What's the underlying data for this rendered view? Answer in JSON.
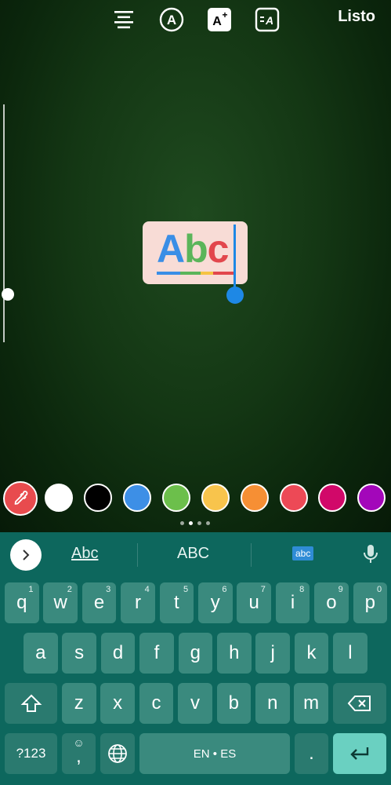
{
  "toolbar": {
    "done_label": "Listo",
    "icons": [
      "align-center-icon",
      "font-style-icon",
      "text-effects-icon",
      "text-animation-icon"
    ]
  },
  "sticker": {
    "text": "Abc",
    "letters": [
      {
        "ch": "A",
        "color": "#3a8ee6"
      },
      {
        "ch": "b",
        "color": "#5bb55a"
      },
      {
        "ch": "c",
        "color": "#e2474d"
      }
    ],
    "underline_colors": [
      "#3a8ee6",
      "#5bb55a",
      "#f6c343",
      "#e2474d"
    ]
  },
  "palette": {
    "colors": [
      "#ffffff",
      "#000000",
      "#3d8fe6",
      "#6cbf4b",
      "#f8c44c",
      "#f68f34",
      "#ed4956",
      "#d10869",
      "#a307ba"
    ],
    "selected_picker_color": "#e84b4e"
  },
  "keyboard": {
    "suggestions": [
      "Abc",
      "ABC",
      "abc"
    ],
    "row1": [
      {
        "key": "q",
        "hint": "1"
      },
      {
        "key": "w",
        "hint": "2"
      },
      {
        "key": "e",
        "hint": "3"
      },
      {
        "key": "r",
        "hint": "4"
      },
      {
        "key": "t",
        "hint": "5"
      },
      {
        "key": "y",
        "hint": "6"
      },
      {
        "key": "u",
        "hint": "7"
      },
      {
        "key": "i",
        "hint": "8"
      },
      {
        "key": "o",
        "hint": "9"
      },
      {
        "key": "p",
        "hint": "0"
      }
    ],
    "row2": [
      "a",
      "s",
      "d",
      "f",
      "g",
      "h",
      "j",
      "k",
      "l"
    ],
    "row3": [
      "z",
      "x",
      "c",
      "v",
      "b",
      "n",
      "m"
    ],
    "symbols_label": "?123",
    "comma_label": ",",
    "space_label": "EN • ES",
    "period_label": "."
  }
}
